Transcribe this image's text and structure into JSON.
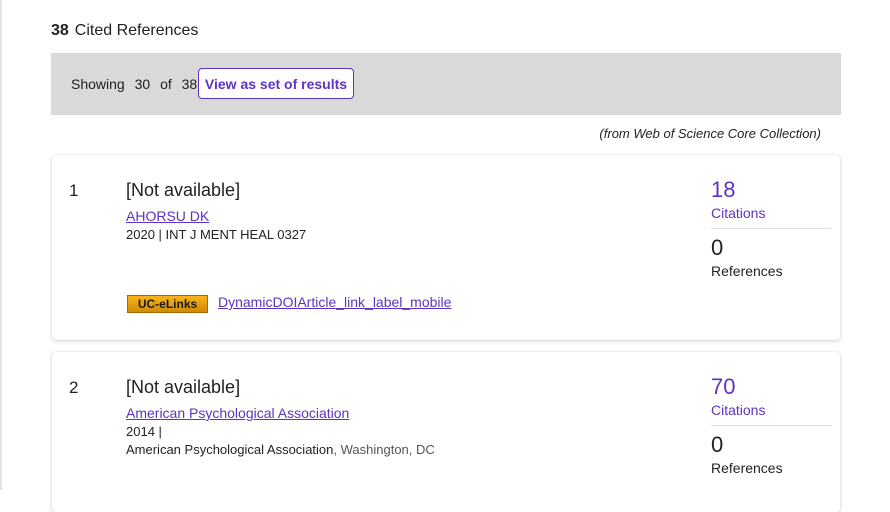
{
  "header": {
    "count": "38",
    "title": "Cited References"
  },
  "showing": {
    "label": "Showing",
    "current": "30",
    "of": "of",
    "total": "38",
    "button": "View as set of results"
  },
  "source_note": "(from Web of Science Core Collection)",
  "records": [
    {
      "number": "1",
      "title": "[Not available]",
      "author": "AHORSU DK",
      "meta": "2020 | INT J MENT HEAL 0327",
      "citations_count": "18",
      "citations_label": "Citations",
      "references_count": "0",
      "references_label": "References",
      "badge": "UC-eLinks",
      "doi_link": "DynamicDOIArticle_link_label_mobile"
    },
    {
      "number": "2",
      "title": "[Not available]",
      "author": "American Psychological Association",
      "meta_line1": "2014 |",
      "publisher": "American Psychological Association",
      "location": ", Washington, DC",
      "citations_count": "70",
      "citations_label": "Citations",
      "references_count": "0",
      "references_label": "References"
    }
  ]
}
